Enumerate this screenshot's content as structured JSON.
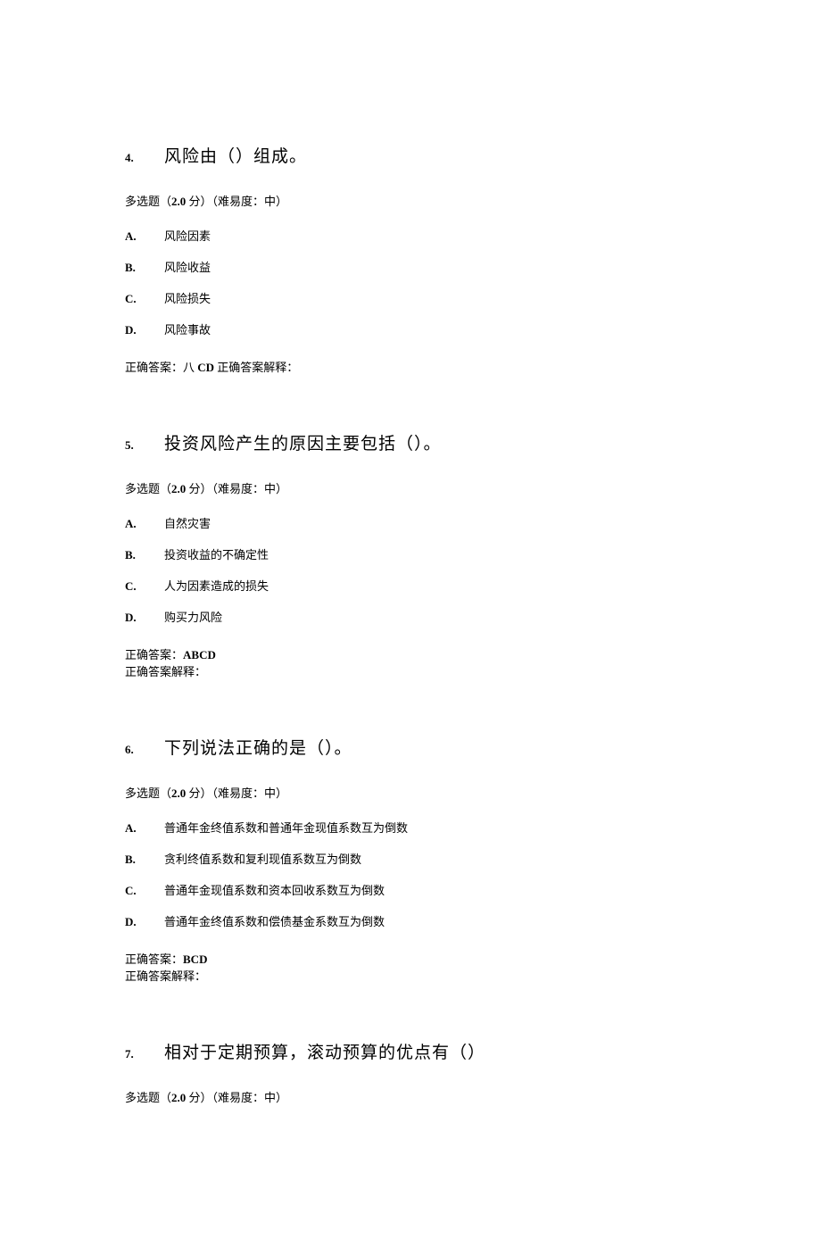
{
  "questions": [
    {
      "num": "4.",
      "title": "风险由（）组成。",
      "meta_prefix": "多选题（",
      "meta_score": "2.0",
      "meta_suffix": " 分）（难易度：中）",
      "options": [
        {
          "letter": "A.",
          "text": "风险因素"
        },
        {
          "letter": "B.",
          "text": "风险收益"
        },
        {
          "letter": "C.",
          "text": "风险损失"
        },
        {
          "letter": "D.",
          "text": "风险事故"
        }
      ],
      "answer_line1_prefix": "正确答案：八 ",
      "answer_line1_bold": "CD",
      "answer_line1_suffix": " 正确答案解释：",
      "answer_line2": ""
    },
    {
      "num": "5.",
      "title": "投资风险产生的原因主要包括（）。",
      "meta_prefix": "多选题（",
      "meta_score": "2.0",
      "meta_suffix": " 分）（难易度：中）",
      "options": [
        {
          "letter": "A.",
          "text": "自然灾害"
        },
        {
          "letter": "B.",
          "text": "投资收益的不确定性"
        },
        {
          "letter": "C.",
          "text": "人为因素造成的损失"
        },
        {
          "letter": "D.",
          "text": "购买力风险"
        }
      ],
      "answer_line1_prefix": "正确答案：",
      "answer_line1_bold": "ABCD",
      "answer_line1_suffix": "",
      "answer_line2": "正确答案解释："
    },
    {
      "num": "6.",
      "title": "下列说法正确的是（）。",
      "meta_prefix": "多选题（",
      "meta_score": "2.0",
      "meta_suffix": " 分）（难易度：中）",
      "options": [
        {
          "letter": "A.",
          "text": "普通年金终值系数和普通年金现值系数互为倒数"
        },
        {
          "letter": "B.",
          "text": "贪利终值系数和复利现值系数互为倒数"
        },
        {
          "letter": "C.",
          "text": "普通年金现值系数和资本回收系数互为倒数"
        },
        {
          "letter": "D.",
          "text": "普通年金终值系数和偿债基金系数互为倒数"
        }
      ],
      "answer_line1_prefix": "正确答案：",
      "answer_line1_bold": "BCD",
      "answer_line1_suffix": "",
      "answer_line2": "正确答案解释："
    },
    {
      "num": "7.",
      "title": "相对于定期预算，滚动预算的优点有（）",
      "meta_prefix": "多选题（",
      "meta_score": "2.0",
      "meta_suffix": " 分）（难易度：中）",
      "options": [],
      "answer_line1_prefix": "",
      "answer_line1_bold": "",
      "answer_line1_suffix": "",
      "answer_line2": ""
    }
  ]
}
